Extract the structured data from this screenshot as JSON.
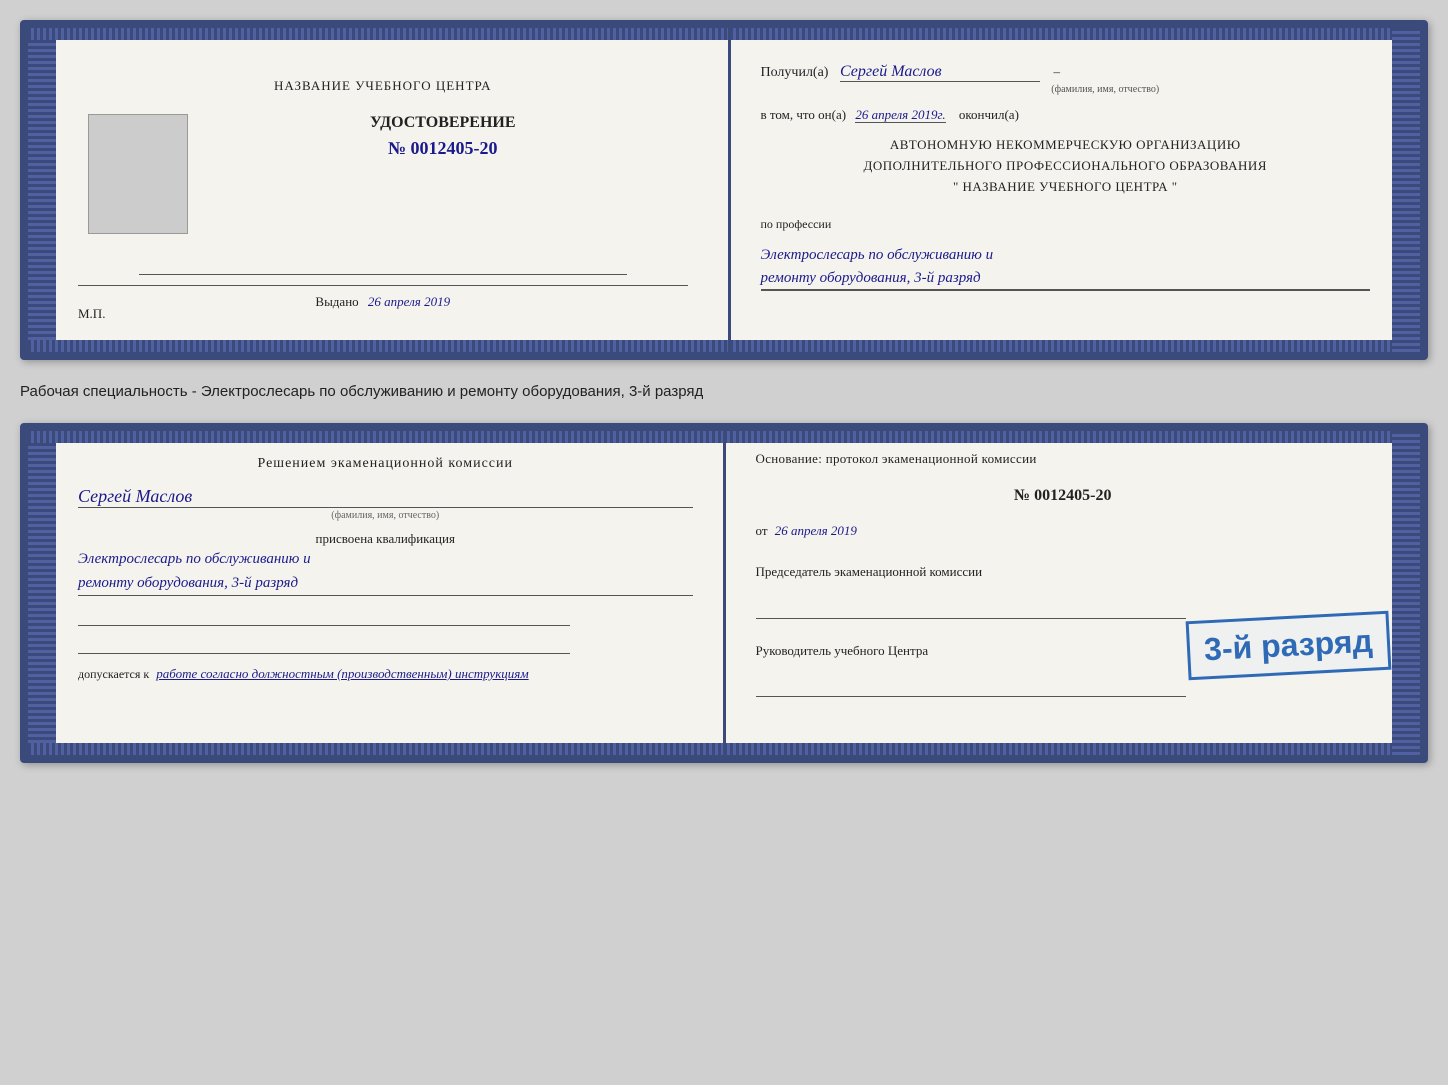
{
  "card1": {
    "left": {
      "center_title": "НАЗВАНИЕ УЧЕБНОГО ЦЕНТРА",
      "cert_title": "УДОСТОВЕРЕНИЕ",
      "cert_number": "№ 0012405-20",
      "issued_label": "Выдано",
      "issued_date": "26 апреля 2019",
      "mp_label": "М.П."
    },
    "right": {
      "received_prefix": "Получил(а)",
      "recipient_name": "Сергей Маслов",
      "fio_label": "(фамилия, имя, отчество)",
      "in_that_prefix": "в том, что он(а)",
      "in_that_date": "26 апреля 2019г.",
      "finished_label": "окончил(а)",
      "org_line1": "АВТОНОМНУЮ НЕКОММЕРЧЕСКУЮ ОРГАНИЗАЦИЮ",
      "org_line2": "ДОПОЛНИТЕЛЬНОГО ПРОФЕССИОНАЛЬНОГО ОБРАЗОВАНИЯ",
      "org_line3": "\" НАЗВАНИЕ УЧЕБНОГО ЦЕНТРА \"",
      "profession_label": "по профессии",
      "profession_line1": "Электрослесарь по обслуживанию и",
      "profession_line2": "ремонту оборудования, 3-й разряд"
    }
  },
  "between_label": "Рабочая специальность - Электрослесарь по обслуживанию и ремонту оборудования, 3-й разряд",
  "card2": {
    "left": {
      "decision_title": "Решением экаменационной комиссии",
      "person_name": "Сергей Маслов",
      "fio_label": "(фамилия, имя, отчество)",
      "assigned_text": "присвоена квалификация",
      "qual_line1": "Электрослесарь по обслуживанию и",
      "qual_line2": "ремонту оборудования, 3-й разряд",
      "allowed_prefix": "допускается к",
      "allowed_text": "работе согласно должностным (производственным) инструкциям"
    },
    "right": {
      "basis_text": "Основание: протокол экаменационной комиссии",
      "basis_number": "№ 0012405-20",
      "from_prefix": "от",
      "basis_date": "26 апреля 2019",
      "chairman_label": "Председатель экаменационной комиссии",
      "head_label": "Руководитель учебного Центра"
    },
    "stamp_text": "3-й разряд"
  }
}
